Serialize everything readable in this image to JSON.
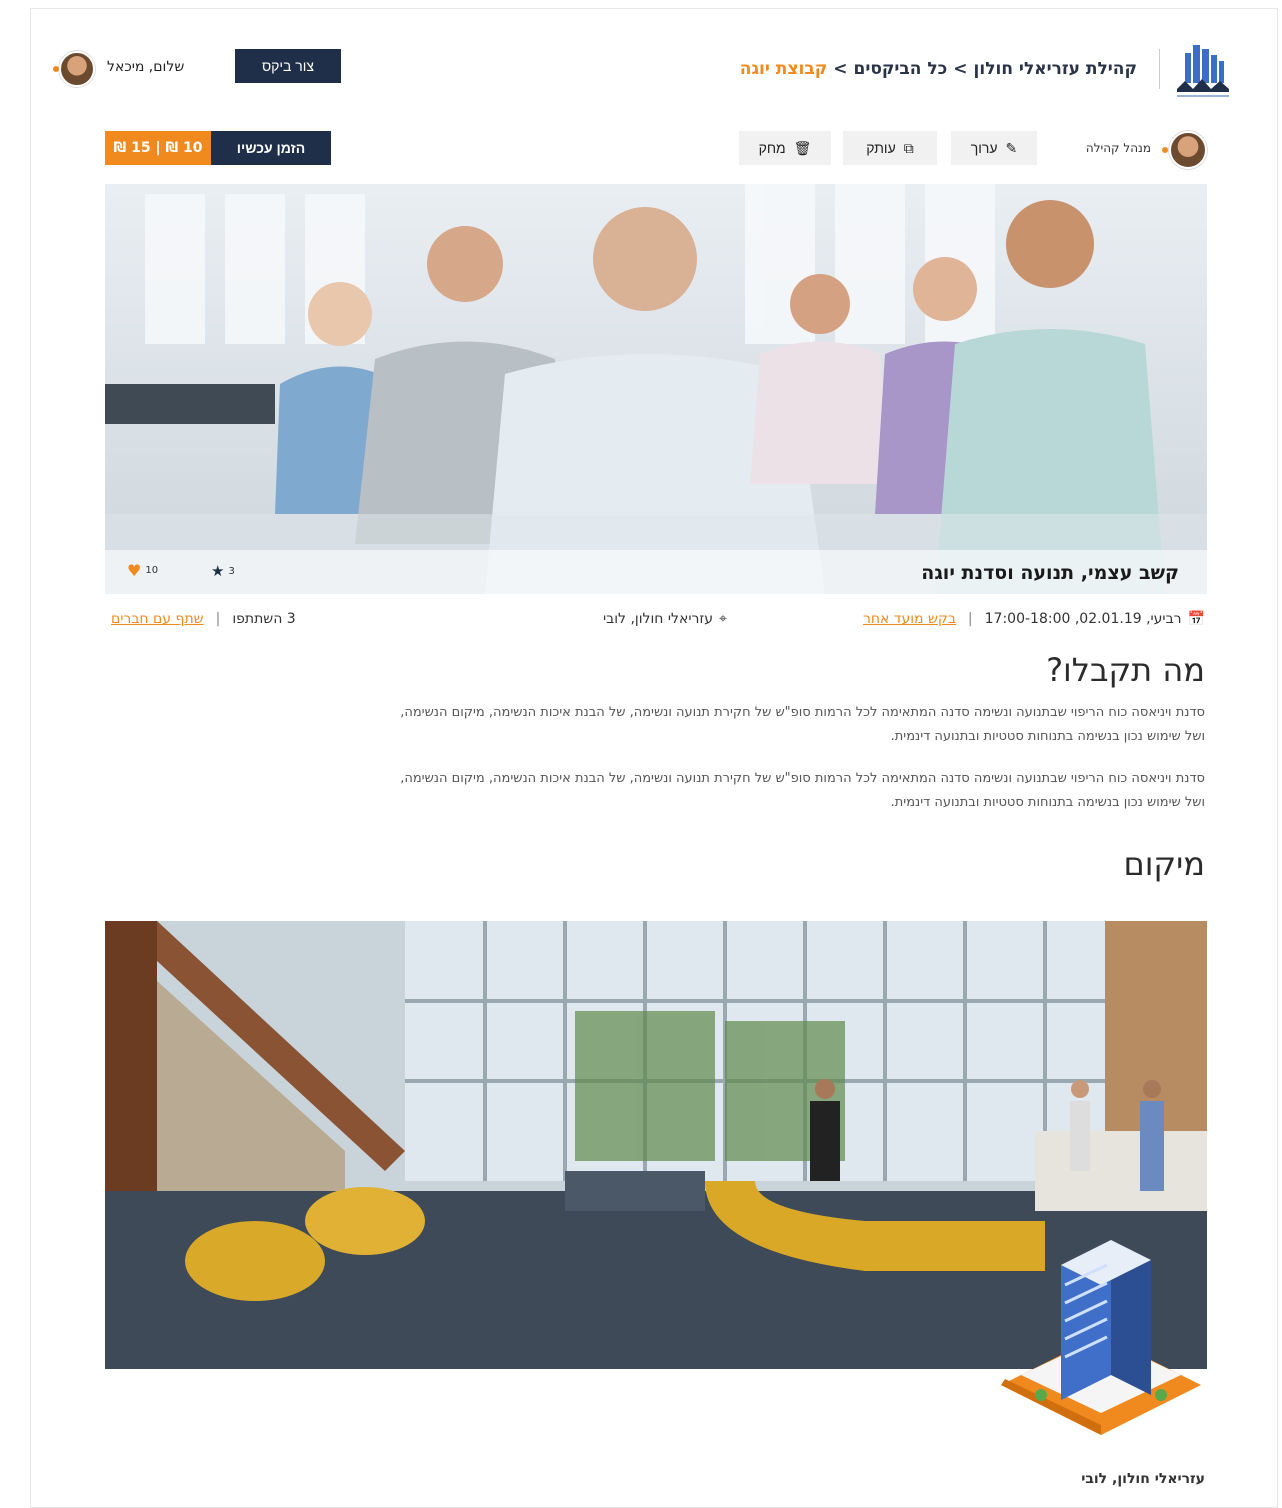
{
  "header": {
    "breadcrumb": {
      "community": "קהילת עזריאלי חולון",
      "separator": ">",
      "all_visits": "כל הביקסים",
      "current": "קבוצת יוגה"
    },
    "create_button": "צור ביקס",
    "greeting": "שלום, מיכאל"
  },
  "toolbar": {
    "admin_label": "מנהל קהילה",
    "edit_label": "ערוך",
    "copy_label": "עותק",
    "delete_label": "מחק",
    "order_label": "הזמן עכשיו",
    "price_text": "10 ₪ | 15 ₪"
  },
  "event": {
    "title": "קשב עצמי, תנועה וסדנת יוגה",
    "likes": "10",
    "rating": "3",
    "date_time": "רביעי, 02.01.19, 17:00-18:00",
    "request_other_time": "בקש מועד אחר",
    "location": "עזריאלי חולון, לובי",
    "participants": "3 השתתפו",
    "share": "שתף עם חברים"
  },
  "what_you_get": {
    "heading": "מה תקבלו?",
    "paragraphs": [
      "סדנת ויניאסה כוח הריפוי שבתנועה ונשימה סדנה המתאימה לכל הרמות סופ\"ש של חקירת תנועה ונשימה, של הבנת איכות הנשימה, מיקום הנשימה, ושל שימוש נכון בנשימה בתנוחות סטטיות ובתנועה דינמית.",
      "סדנת ויניאסה כוח הריפוי שבתנועה ונשימה סדנה המתאימה לכל הרמות סופ\"ש של חקירת תנועה ונשימה, של הבנת איכות הנשימה, מיקום הנשימה, ושל שימוש נכון בנשימה בתנוחות סטטיות ובתנועה דינמית."
    ]
  },
  "location_section": {
    "heading": "מיקום",
    "name": "עזריאלי חולון, לובי"
  },
  "colors": {
    "accent": "#f08a1e",
    "navy": "#1f2f4a"
  }
}
